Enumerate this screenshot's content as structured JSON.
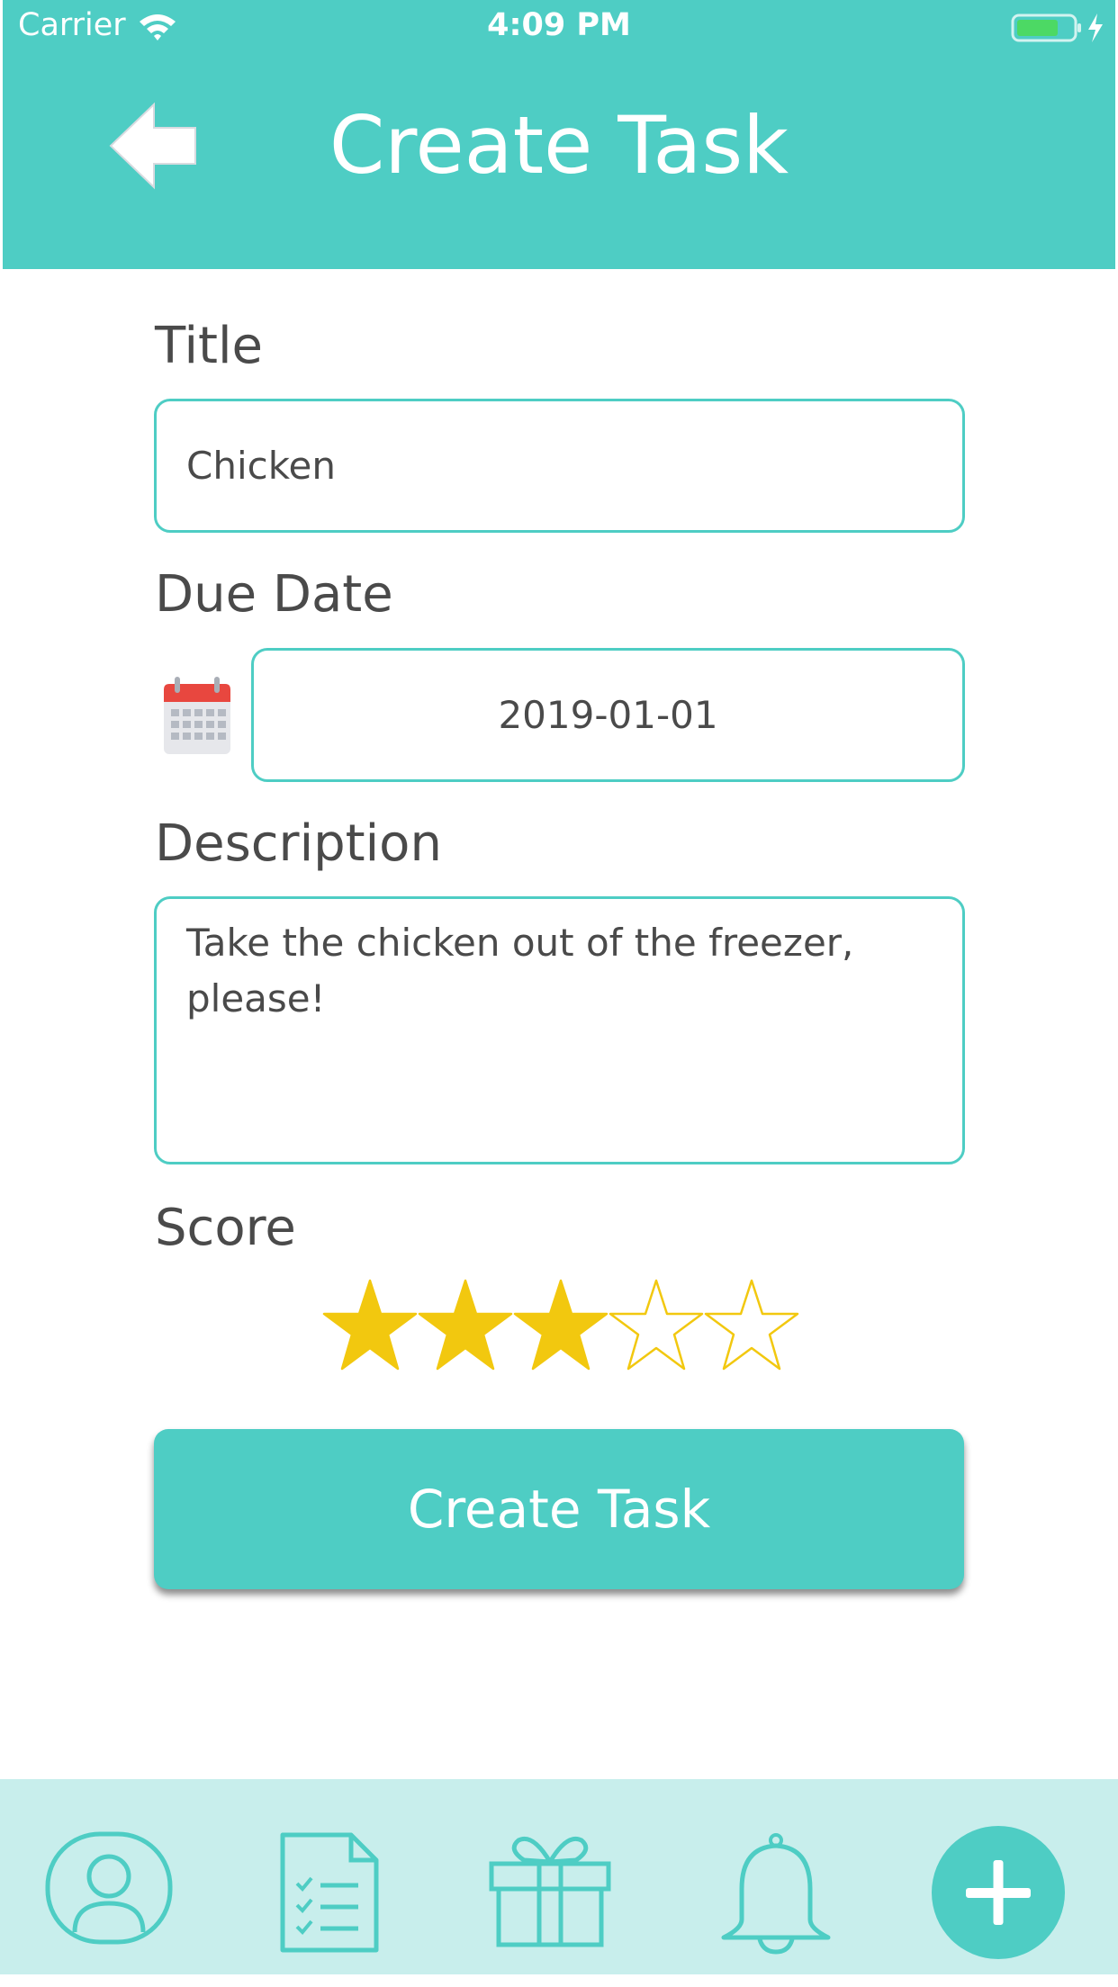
{
  "status_bar": {
    "carrier": "Carrier",
    "time": "4:09 PM"
  },
  "header": {
    "title": "Create Task",
    "back_icon": "back-arrow-icon"
  },
  "form": {
    "title_label": "Title",
    "title_value": "Chicken",
    "due_date_label": "Due Date",
    "due_date_value": "2019-01-01",
    "description_label": "Description",
    "description_value": "Take the chicken out of the freezer, please!",
    "score_label": "Score",
    "score": {
      "value": 3,
      "max": 5
    },
    "submit_label": "Create Task"
  },
  "tabbar": {
    "items": [
      {
        "icon": "profile-icon"
      },
      {
        "icon": "task-list-icon"
      },
      {
        "icon": "gift-icon"
      },
      {
        "icon": "bell-icon"
      },
      {
        "icon": "plus-icon"
      }
    ]
  },
  "colors": {
    "accent": "#4ecdc4",
    "tabbar_background": "#c8eeec",
    "star_filled": "#f2c80f",
    "text": "#4a4a4a"
  }
}
